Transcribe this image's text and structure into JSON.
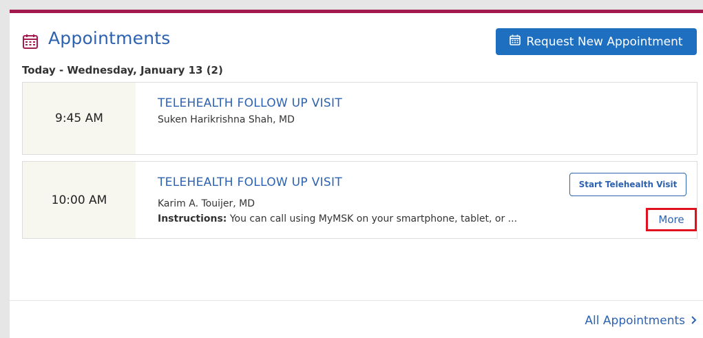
{
  "header": {
    "title": "Appointments",
    "request_button_label": "Request New Appointment"
  },
  "date_heading": "Today - Wednesday, January 13 (2)",
  "appointments": [
    {
      "time": "9:45 AM",
      "visit_type": "TELEHEALTH FOLLOW UP VISIT",
      "doctor": "Suken Harikrishna Shah, MD"
    },
    {
      "time": "10:00 AM",
      "visit_type": "TELEHEALTH FOLLOW UP VISIT",
      "doctor": "Karim A. Touijer, MD",
      "instructions_label": "Instructions:",
      "instructions_text": "You can call using MyMSK on your smartphone, tablet, or ...",
      "telehealth_button_label": "Start Telehealth Visit",
      "more_label": "More"
    }
  ],
  "footer": {
    "all_appointments_label": "All Appointments",
    "chevron_icon": "chevron-right-icon"
  },
  "colors": {
    "accent_bar": "#a31a4e",
    "primary_blue": "#1f6fc1",
    "link_blue": "#2c62b0",
    "highlight_red": "#e0101e",
    "time_cell_bg": "#f7f7f0"
  },
  "icons": {
    "header_icon": "calendar-icon",
    "button_icon": "calendar-icon"
  }
}
